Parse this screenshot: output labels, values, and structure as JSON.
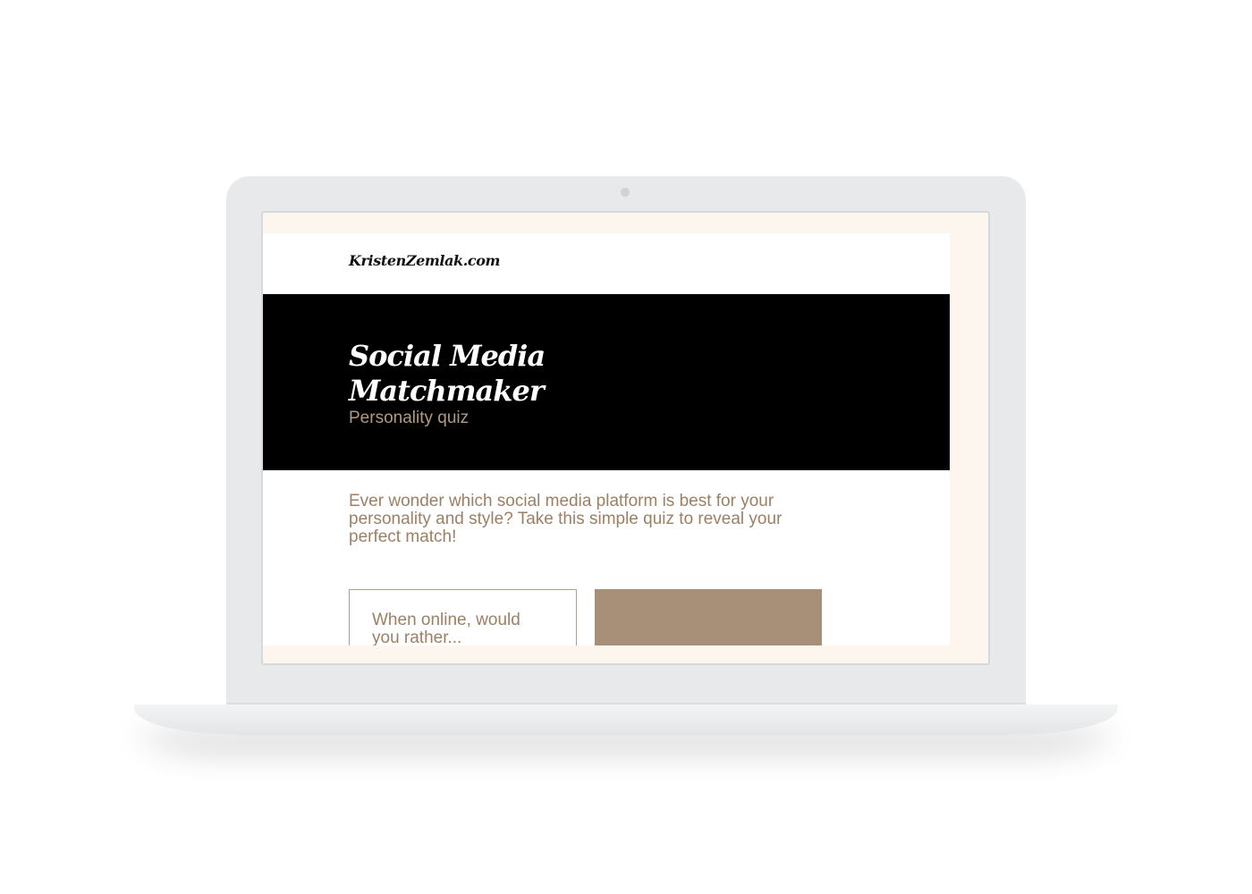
{
  "site": {
    "logo_text": "KristenZemlak.com"
  },
  "hero": {
    "title": "Social Media Matchmaker",
    "subtitle": "Personality quiz"
  },
  "intro": {
    "text": "Ever wonder which social media platform is best for your personality and style? Take this simple quiz to reveal your perfect match!"
  },
  "quiz": {
    "question": "When online, would you rather..."
  },
  "colors": {
    "accent": "#a88f78",
    "text_accent": "#9c8063",
    "hero_background": "#000000",
    "screen_background": "#fdf6ee"
  }
}
